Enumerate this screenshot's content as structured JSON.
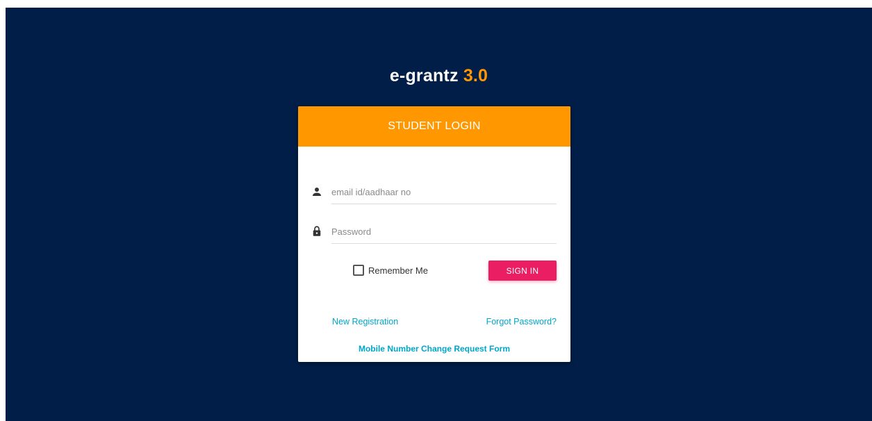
{
  "brand": {
    "name": "e-grantz",
    "version": "3.0",
    "accent_color": "#ff9800"
  },
  "login_card": {
    "header": "STUDENT LOGIN",
    "header_color": "#ff9800",
    "username": {
      "icon": "person-icon",
      "placeholder": "email id/aadhaar no",
      "value": ""
    },
    "password": {
      "icon": "lock-icon",
      "placeholder": "Password",
      "value": ""
    },
    "remember_me": {
      "label": "Remember Me",
      "checked": false
    },
    "sign_in_label": "SIGN IN",
    "sign_in_color": "#e91e63",
    "links": {
      "new_registration": "New Registration",
      "forgot_password": "Forgot Password?",
      "mobile_change": "Mobile Number Change Request Form"
    },
    "link_color": "#00a6c8"
  },
  "background_color": "#001e47"
}
